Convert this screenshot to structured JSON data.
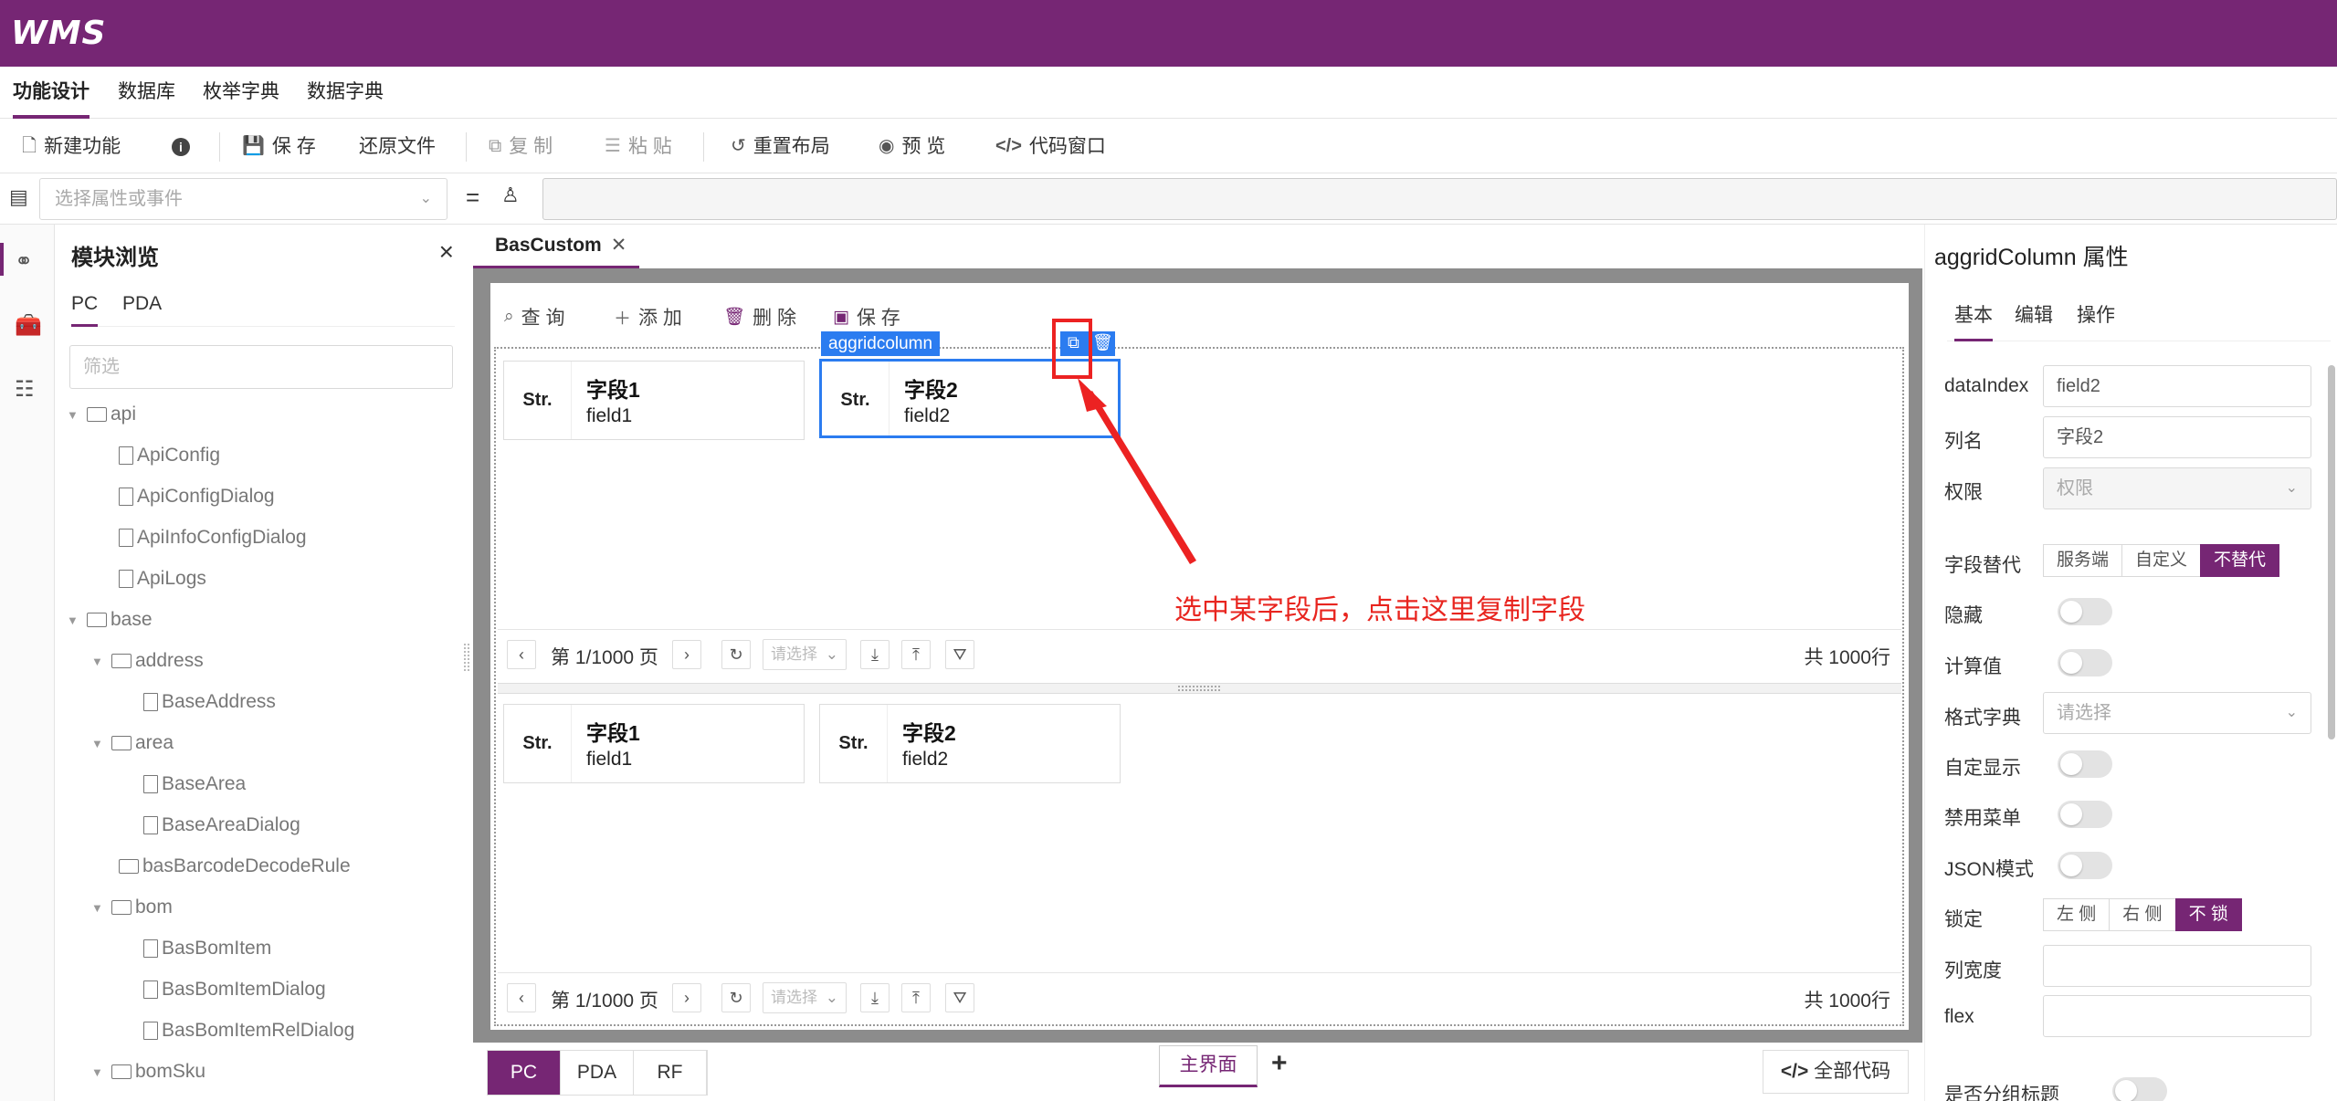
{
  "app": {
    "logo": "WMS",
    "brand_color": "#762674"
  },
  "menu": [
    "功能设计",
    "数据库",
    "枚举字典",
    "数据字典"
  ],
  "toolbar": {
    "new": "新建功能",
    "save": "保 存",
    "restore": "还原文件",
    "copy": "复 制",
    "paste": "粘 贴",
    "reset_layout": "重置布局",
    "preview": "预 览",
    "code_window": "代码窗口"
  },
  "propbar": {
    "placeholder": "选择属性或事件"
  },
  "browser": {
    "title": "模块浏览",
    "tabs": [
      "PC",
      "PDA"
    ],
    "filter_placeholder": "筛选",
    "tree": [
      "api",
      "ApiConfig",
      "ApiConfigDialog",
      "ApiInfoConfigDialog",
      "ApiLogs",
      "base",
      "address",
      "BaseAddress",
      "area",
      "BaseArea",
      "BaseAreaDialog",
      "basBarcodeDecodeRule",
      "bom",
      "BasBomItem",
      "BasBomItemDialog",
      "BasBomItemRelDialog",
      "bomSku"
    ]
  },
  "editor": {
    "tab": "BasCustom",
    "buttons": [
      "查 询",
      "添 加",
      "删 除",
      "保 存"
    ],
    "selected_label": "aggridcolumn",
    "columns": [
      {
        "type": "Str.",
        "name": "字段1",
        "field": "field1"
      },
      {
        "type": "Str.",
        "name": "字段2",
        "field": "field2"
      }
    ],
    "pager": {
      "page": "第 1/1000 页",
      "select": "请选择",
      "total": "共 1000行"
    },
    "annotation": "选中某字段后，点击这里复制字段"
  },
  "bottom": {
    "tabs": [
      "PC",
      "PDA",
      "RF"
    ],
    "main_view": "主界面",
    "plus": "+",
    "all_code": "全部代码"
  },
  "props": {
    "title": "aggridColumn 属性",
    "tabs": [
      "基本",
      "编辑",
      "操作"
    ],
    "dataIndex_label": "dataIndex",
    "dataIndex_value": "field2",
    "colname_label": "列名",
    "colname_value": "字段2",
    "perm_label": "权限",
    "perm_value": "权限",
    "substitute_label": "字段替代",
    "substitute_options": [
      "服务端",
      "自定义",
      "不替代"
    ],
    "hidden_label": "隐藏",
    "calc_label": "计算值",
    "format_label": "格式字典",
    "format_placeholder": "请选择",
    "custom_label": "自定显示",
    "disable_menu_label": "禁用菜单",
    "json_label": "JSON模式",
    "lock_label": "锁定",
    "lock_options": [
      "左 侧",
      "右 侧",
      "不 锁"
    ],
    "width_label": "列宽度",
    "flex_label": "flex",
    "group_label": "是否分组标题"
  }
}
